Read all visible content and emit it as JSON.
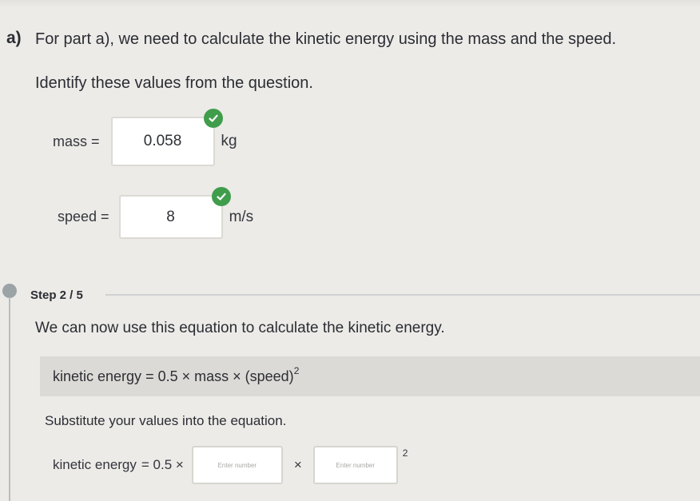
{
  "part": {
    "letter": "a)",
    "heading": "For part a), we need to calculate the kinetic energy using the mass and the speed.",
    "instruction": "Identify these values from the question."
  },
  "fields": {
    "mass": {
      "label": "mass =",
      "value": "0.058",
      "unit": "kg",
      "status": "correct"
    },
    "speed": {
      "label": "speed =",
      "value": "8",
      "unit": "m/s",
      "status": "correct"
    }
  },
  "step": {
    "label": "Step 2 / 5",
    "sentence": "We can now use this equation to calculate the kinetic energy.",
    "equation": {
      "lhs": "kinetic energy",
      "rhs": "= 0.5 × mass × (speed)",
      "exponent": "2"
    },
    "substitute_instruction": "Substitute your values into the equation.",
    "substitution": {
      "lhs": "kinetic energy",
      "prefix": "= 0.5 ×",
      "times": "×",
      "exponent": "2",
      "box1_placeholder": "Enter number",
      "box2_placeholder": "Enter number"
    }
  },
  "colors": {
    "check_green": "#3f9d4b",
    "band": "#dcdad6",
    "background": "#ecebe8"
  }
}
